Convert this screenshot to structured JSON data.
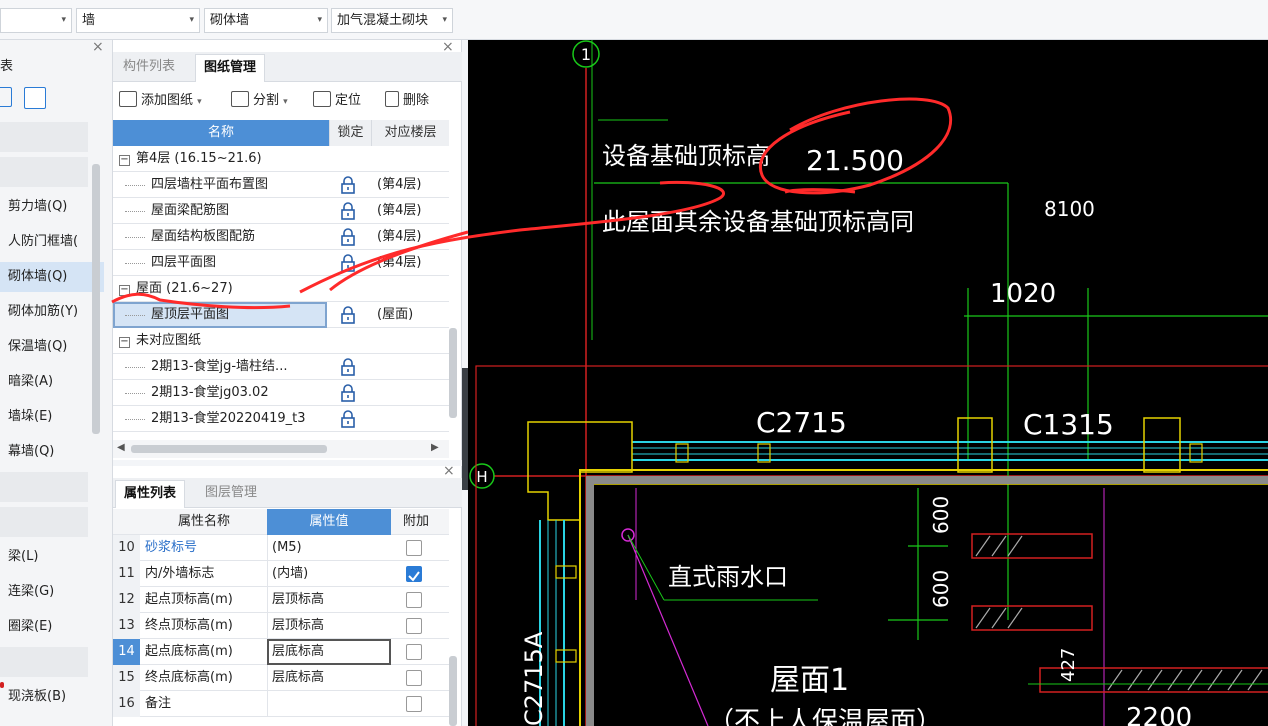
{
  "toolbar": {
    "dropdowns": [
      {
        "value": "",
        "name": "category-dropdown"
      },
      {
        "value": "墙",
        "name": "type-dropdown"
      },
      {
        "value": "砌体墙",
        "name": "subtype-dropdown"
      },
      {
        "value": "加气混凝土砌块",
        "name": "material-dropdown"
      }
    ]
  },
  "leftnav": {
    "partial_title": "表",
    "items": [
      "剪力墙(Q)",
      "人防门框墙(",
      "砌体墙(Q)",
      "砌体加筋(Y)",
      "保温墙(Q)",
      "暗梁(A)",
      "墙垛(E)",
      "幕墙(Q)",
      "梁(L)",
      "连梁(G)",
      "圈梁(E)",
      "现浇板(B)"
    ],
    "selected": "砌体墙(Q)"
  },
  "drawpanel": {
    "tabs": [
      "构件列表",
      "图纸管理"
    ],
    "active_tab": "图纸管理",
    "actions": [
      "添加图纸",
      "分割",
      "定位",
      "删除"
    ],
    "headers": [
      "名称",
      "锁定",
      "对应楼层"
    ],
    "rows": [
      {
        "type": "group",
        "name": "第4层 (16.15~21.6)"
      },
      {
        "type": "item",
        "name": "四层墙柱平面布置图",
        "floor": "(第4层)"
      },
      {
        "type": "item",
        "name": "屋面梁配筋图",
        "floor": "(第4层)"
      },
      {
        "type": "item",
        "name": "屋面结构板图配筋",
        "floor": "(第4层)"
      },
      {
        "type": "item",
        "name": "四层平面图",
        "floor": "(第4层)"
      },
      {
        "type": "group",
        "name": "屋面 (21.6~27)"
      },
      {
        "type": "item",
        "name": "屋顶层平面图",
        "floor": "(屋面)",
        "selected": true
      },
      {
        "type": "group",
        "name": "未对应图纸"
      },
      {
        "type": "item",
        "name": "2期13-食堂jg-墙柱结...",
        "floor": ""
      },
      {
        "type": "item",
        "name": "2期13-食堂jg03.02",
        "floor": ""
      },
      {
        "type": "item",
        "name": "2期13-食堂20220419_t3",
        "floor": ""
      }
    ]
  },
  "proppanel": {
    "tabs": [
      "属性列表",
      "图层管理"
    ],
    "active_tab": "属性列表",
    "headers": [
      "属性名称",
      "属性值",
      "附加"
    ],
    "rows": [
      {
        "num": "10",
        "name": "砂浆标号",
        "value": "(M5)",
        "checked": false,
        "link": true
      },
      {
        "num": "11",
        "name": "内/外墙标志",
        "value": "(内墙)",
        "checked": true
      },
      {
        "num": "12",
        "name": "起点顶标高(m)",
        "value": "层顶标高",
        "checked": false
      },
      {
        "num": "13",
        "name": "终点顶标高(m)",
        "value": "层顶标高",
        "checked": false
      },
      {
        "num": "14",
        "name": "起点底标高(m)",
        "value": "层底标高",
        "checked": false,
        "selected": true
      },
      {
        "num": "15",
        "name": "终点底标高(m)",
        "value": "层底标高",
        "checked": false
      },
      {
        "num": "16",
        "name": "备注",
        "value": "",
        "checked": false
      }
    ]
  },
  "cad": {
    "axis_1": "1",
    "axis_h": "H",
    "label_equipment": "设备基础顶标高",
    "value_equipment": "21.500",
    "note_same": "此屋面其余设备基础顶标高同",
    "dim_8100": "8100",
    "dim_1020": "1020",
    "win_c2715": "C2715",
    "win_c1315": "C1315",
    "dim_600a": "600",
    "dim_600b": "600",
    "dim_427": "427",
    "dim_2200": "2200",
    "drain": "直式雨水口",
    "roof_title": "屋面1",
    "roof_sub": "（不上人保温屋面）",
    "c2715a": "C2715A"
  },
  "colors": {
    "cad_bg": "#000000",
    "green": "#19c819",
    "red": "#d32020",
    "yellow": "#e6d200",
    "cyan": "#2ad4e4",
    "magenta": "#d42ad4",
    "accent_blue": "#4d8fd6",
    "ink_red": "#ff2a2a"
  }
}
